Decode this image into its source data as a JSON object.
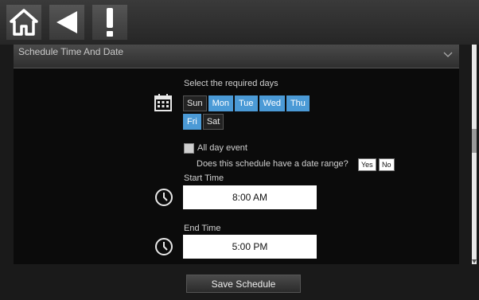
{
  "header": {
    "icons": [
      "home-icon",
      "back-arrow-icon",
      "alert-icon"
    ]
  },
  "section": {
    "title": "Schedule Time And Date"
  },
  "days": {
    "prompt": "Select the required days",
    "items": [
      {
        "label": "Sun",
        "selected": false
      },
      {
        "label": "Mon",
        "selected": true
      },
      {
        "label": "Tue",
        "selected": true
      },
      {
        "label": "Wed",
        "selected": true
      },
      {
        "label": "Thu",
        "selected": true
      },
      {
        "label": "Fri",
        "selected": true
      },
      {
        "label": "Sat",
        "selected": false
      }
    ]
  },
  "all_day": {
    "label": "All day event",
    "checked": false
  },
  "date_range": {
    "question": "Does this schedule have a date range?",
    "yes": "Yes",
    "no": "No"
  },
  "start": {
    "label": "Start Time",
    "value": "8:00 AM"
  },
  "end": {
    "label": "End Time",
    "value": "5:00 PM"
  },
  "footer": {
    "save_label": "Save Schedule"
  },
  "colors": {
    "selected_day": "#4b9ad6",
    "background": "#1a1a1a"
  }
}
